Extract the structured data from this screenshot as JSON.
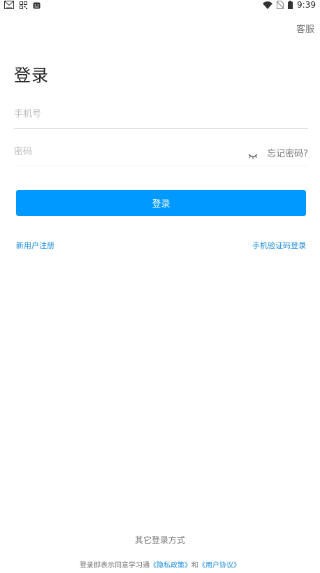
{
  "status_bar": {
    "time": "9:39",
    "icons": [
      "mail-icon",
      "qr-grid-icon",
      "android-icon",
      "wifi-icon",
      "no-sim-icon",
      "battery-icon"
    ]
  },
  "header": {
    "service_label": "客服"
  },
  "login": {
    "title": "登录",
    "phone_placeholder": "手机号",
    "phone_value": "",
    "password_placeholder": "密码",
    "password_value": "",
    "password_toggle_icon": "eye-closed-icon",
    "forgot_label": "忘记密码?",
    "submit_label": "登录",
    "register_label": "新用户注册",
    "sms_login_label": "手机验证码登录"
  },
  "footer": {
    "other_login_label": "其它登录方式",
    "agreement_prefix": "登录即表示同意学习通",
    "privacy_label": "《隐私政策》",
    "and_label": "和",
    "terms_label": "《用户协议》"
  },
  "colors": {
    "accent": "#0099ff",
    "link": "#1a8cdc",
    "muted_text": "#777777",
    "placeholder": "#bdbdbd"
  }
}
